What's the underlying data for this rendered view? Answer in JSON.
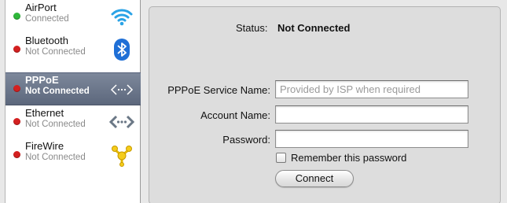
{
  "services": [
    {
      "name": "AirPort",
      "status": "Connected",
      "status_color": "#2fb73a",
      "icon": "wifi-icon"
    },
    {
      "name": "Bluetooth",
      "status": "Not Connected",
      "status_color": "#d42020",
      "icon": "bluetooth-icon"
    },
    {
      "name": "PPPoE",
      "status": "Not Connected",
      "status_color": "#d42020",
      "icon": "pppoe-icon",
      "selected": true
    },
    {
      "name": "Ethernet",
      "status": "Not Connected",
      "status_color": "#d42020",
      "icon": "ethernet-icon"
    },
    {
      "name": "FireWire",
      "status": "Not Connected",
      "status_color": "#d42020",
      "icon": "firewire-icon"
    }
  ],
  "panel": {
    "status_label": "Status:",
    "status_value": "Not Connected",
    "service_name_label": "PPPoE Service Name:",
    "service_name_placeholder": "Provided by ISP when required",
    "service_name_value": "",
    "account_name_label": "Account Name:",
    "account_name_value": "",
    "password_label": "Password:",
    "password_value": "",
    "remember_label": "Remember this password",
    "remember_checked": false,
    "connect_label": "Connect"
  },
  "colors": {
    "selection": "#657086",
    "connected": "#2fb73a",
    "disconnected": "#d42020"
  }
}
